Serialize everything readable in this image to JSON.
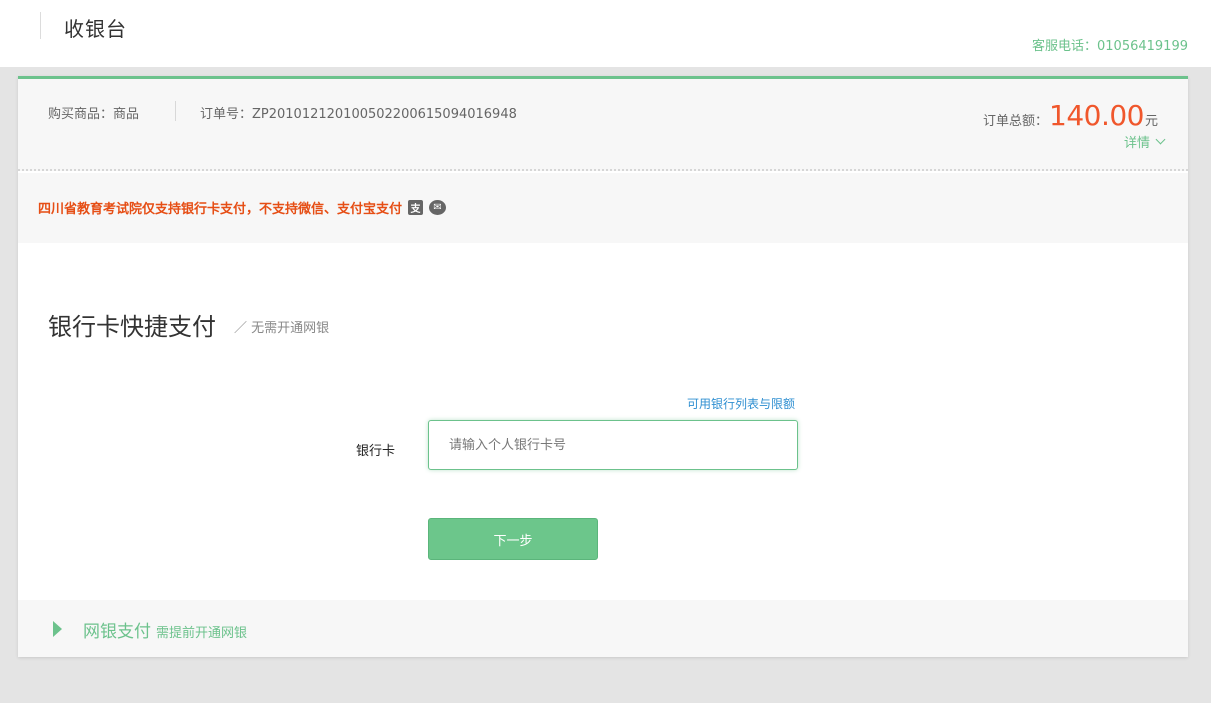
{
  "header": {
    "title": "收银台",
    "hotline": "客服电话：01056419199"
  },
  "order": {
    "item_label": "购买商品：商品",
    "order_no_label": "订单号：ZP201012120100502200615094016948",
    "total_label": "订单总额：",
    "total_amount": "140.00",
    "total_unit": "元",
    "details_label": "详情"
  },
  "notice": {
    "text": "四川省教育考试院仅支持银行卡支付，不支持微信、支付宝支付",
    "alipay_icon": "支",
    "wechat_icon": "✉"
  },
  "quick_pay": {
    "title": "银行卡快捷支付",
    "subtitle": "／ 无需开通网银",
    "bank_list_link": "可用银行列表与限额",
    "card_label": "银行卡",
    "card_placeholder": "请输入个人银行卡号",
    "card_value": "",
    "next_button": "下一步"
  },
  "net_bank": {
    "label": "网银支付",
    "hint": "需提前开通网银"
  },
  "colors": {
    "accent_green": "#6cc28c",
    "amount_orange": "#f0572c",
    "notice_red": "#e64e15",
    "link_blue": "#2f8fd1"
  }
}
